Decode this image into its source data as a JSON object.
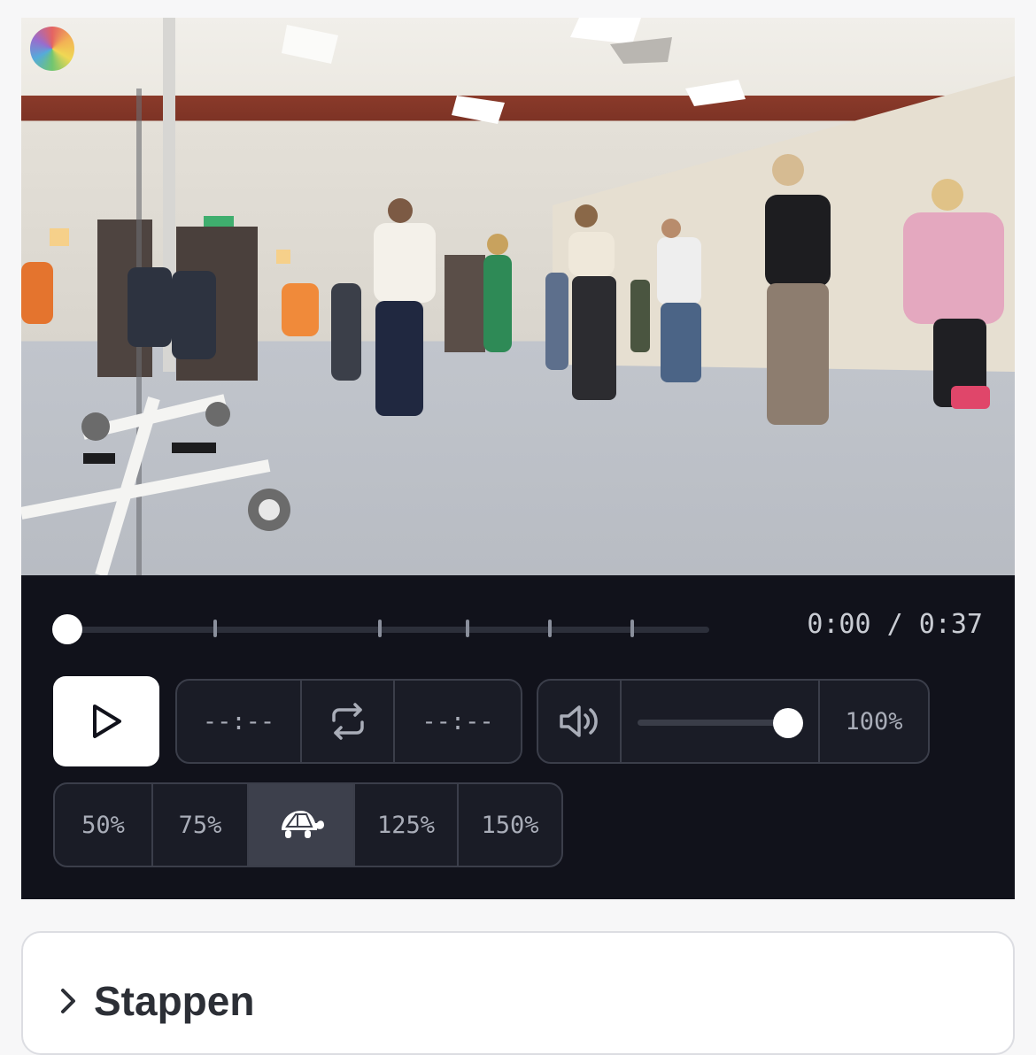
{
  "player": {
    "current_time": "0:00",
    "duration": "0:37",
    "time_display": "0:00 / 0:37",
    "progress_fraction": 0,
    "loop": {
      "start": "--:--",
      "end": "--:--"
    },
    "volume": {
      "level_fraction": 1.0,
      "label": "100%"
    },
    "speeds": [
      {
        "label": "50%",
        "active": false
      },
      {
        "label": "75%",
        "active": false
      },
      {
        "label": "",
        "icon": "turtle-icon",
        "active": true
      },
      {
        "label": "125%",
        "active": false
      },
      {
        "label": "150%",
        "active": false
      }
    ]
  },
  "icons": {
    "play": "play-icon",
    "loop": "repeat-icon",
    "volume": "volume-icon",
    "speed_normal": "turtle-icon",
    "collapse": "chevron-right-icon"
  },
  "section": {
    "title": "Stappen",
    "expanded": false
  },
  "colors": {
    "controls_bg": "#11121b",
    "button_border": "#3b3e4a",
    "accent": "#ffffff"
  }
}
